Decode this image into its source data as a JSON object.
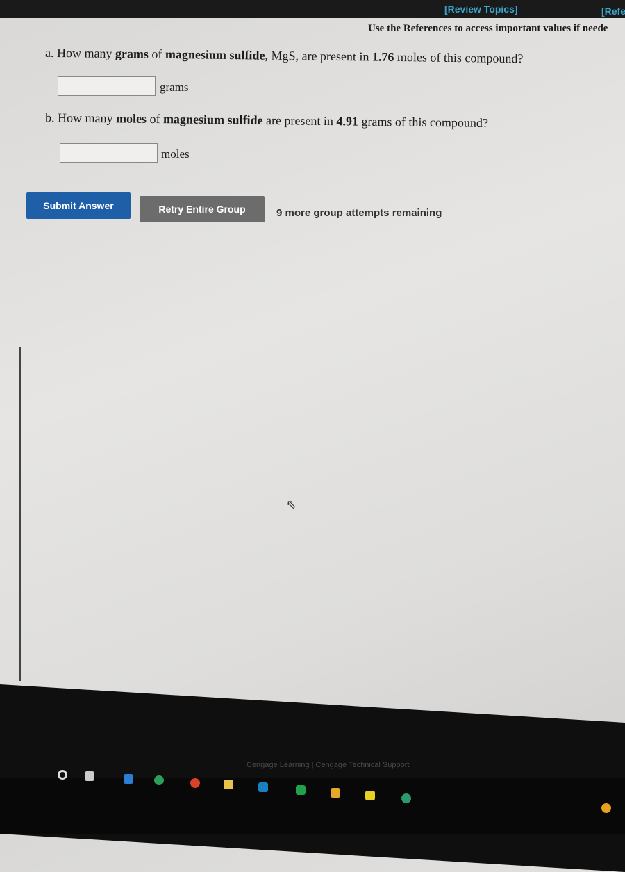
{
  "header": {
    "review_topics": "[Review Topics]",
    "references": "[Refe",
    "use_references": "Use the References to access important values if neede"
  },
  "question_a": {
    "pre": "a. How many ",
    "b1": "grams",
    "mid1": " of ",
    "b2": "magnesium sulfide",
    "mid2": ", MgS, are present in ",
    "b3": "1.76",
    "post": " moles of this compound?",
    "input_value": "",
    "unit": "grams"
  },
  "question_b": {
    "pre": "b. How many ",
    "b1": "moles",
    "mid1": " of ",
    "b2": "magnesium sulfide",
    "mid2": " are present in ",
    "b3": "4.91",
    "post": " grams of this compound?",
    "input_value": "",
    "unit": "moles"
  },
  "actions": {
    "submit": "Submit Answer",
    "retry": "Retry Entire Group",
    "remaining": "9 more group attempts remaining"
  },
  "footer": {
    "text": "Cengage Learning | Cengage Technical Support"
  },
  "colors": {
    "link": "#3aa6cc",
    "submit": "#1f5fa8",
    "retry": "#6c6c6c"
  }
}
